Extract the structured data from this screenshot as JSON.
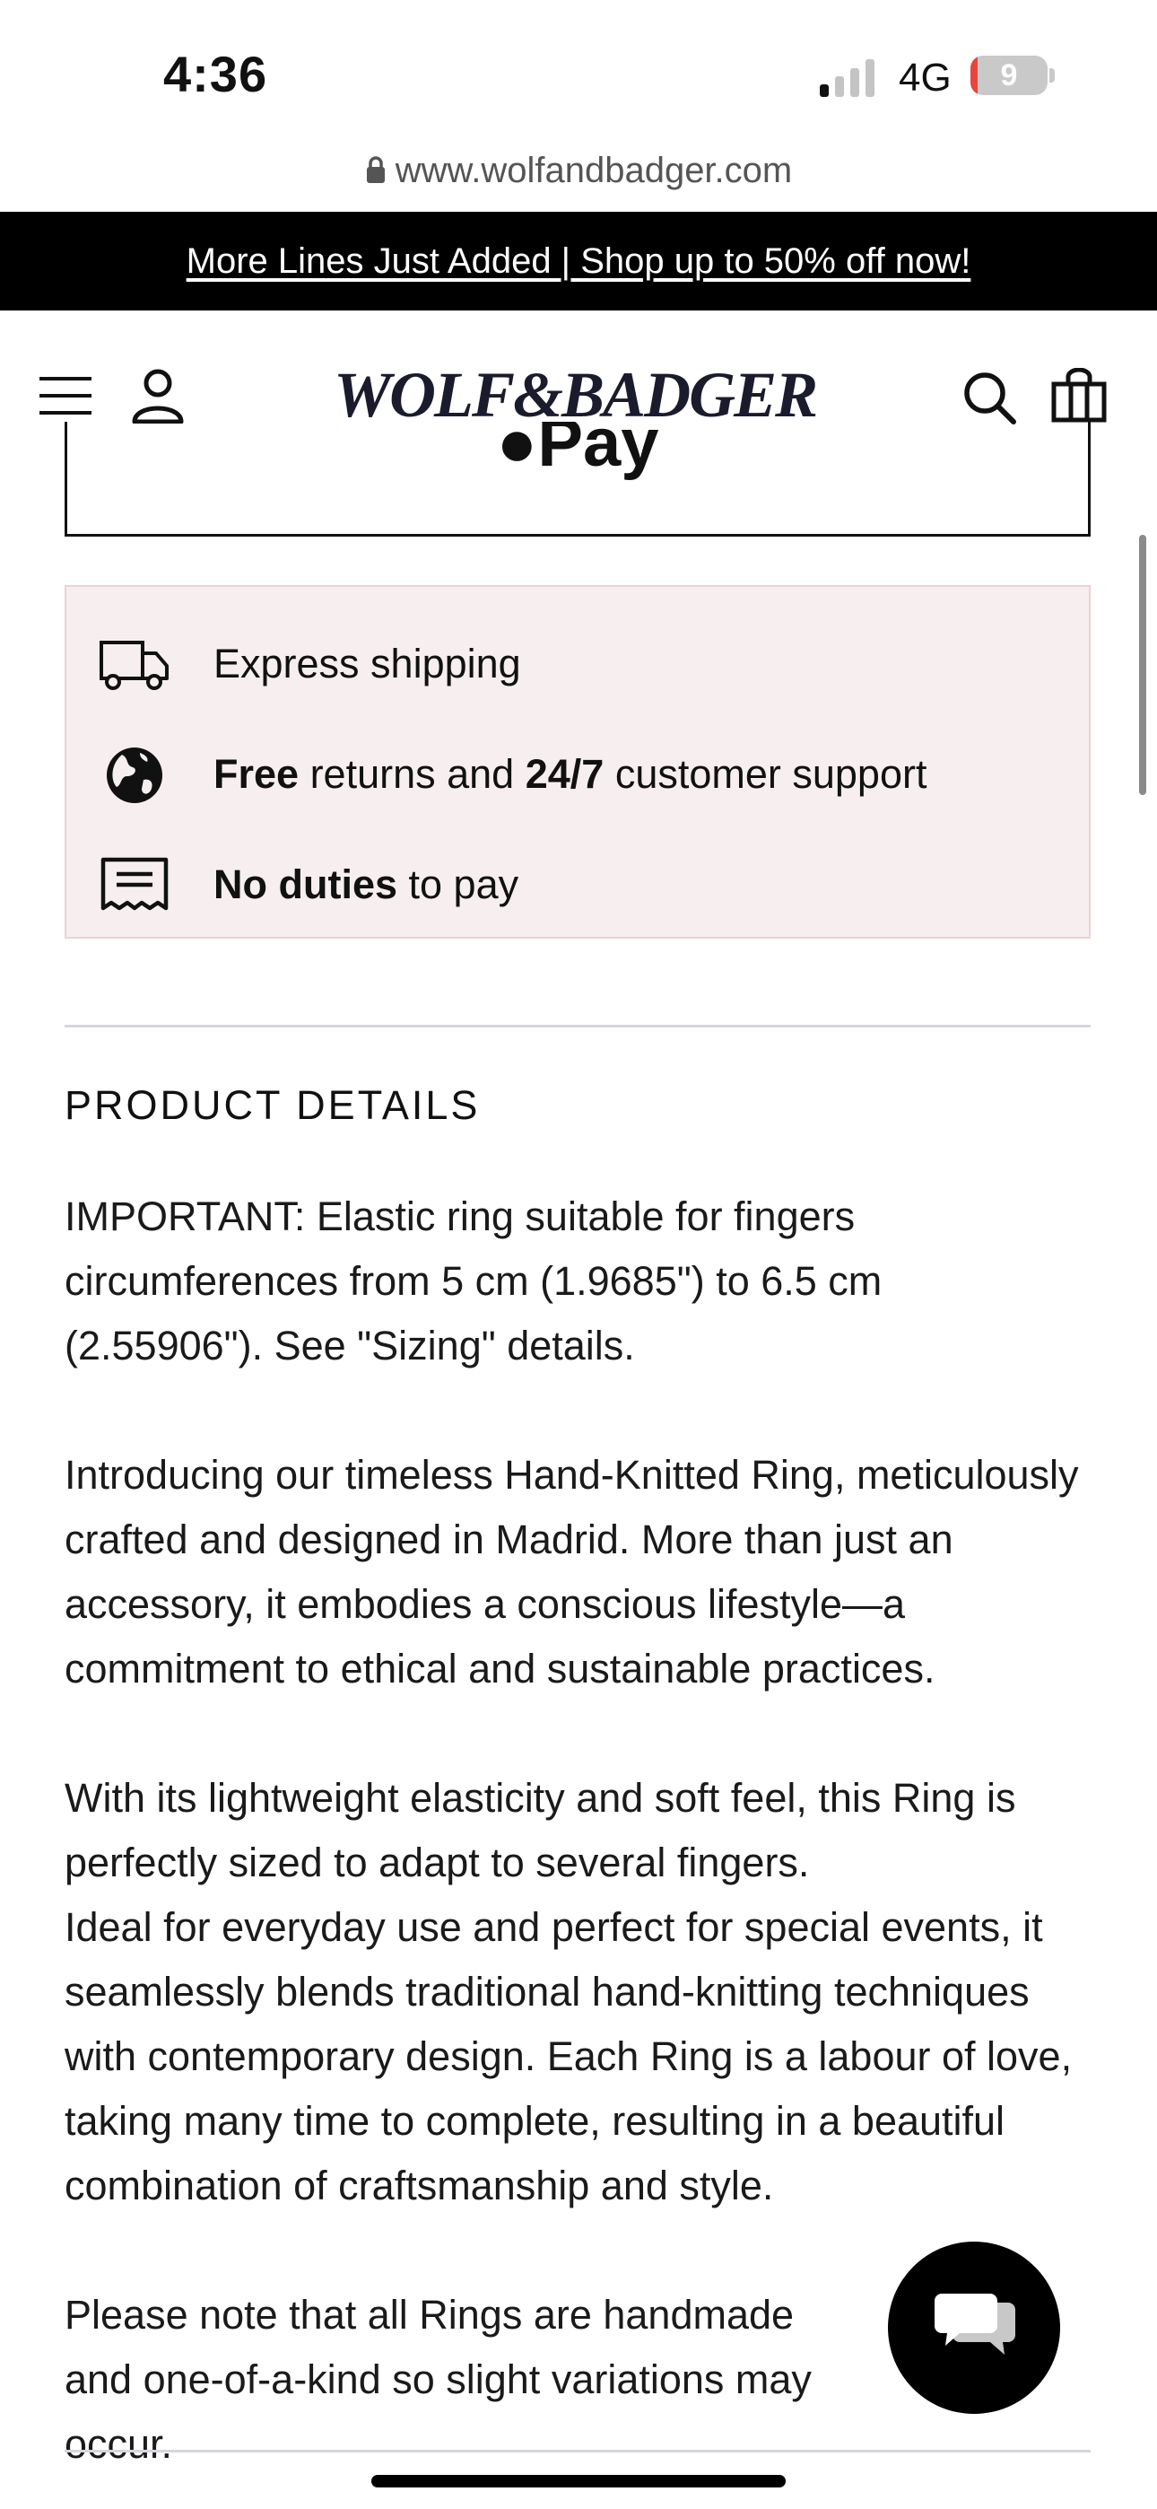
{
  "status_bar": {
    "time": "4:36",
    "network": "4G",
    "battery": "9",
    "battery_fraction": 0.09
  },
  "browser": {
    "url": "www.wolfandbadger.com"
  },
  "promo_banner": {
    "text": "More Lines Just Added | Shop up to 50% off now!"
  },
  "header": {
    "logo": "WOLF&BADGER"
  },
  "pay_button": {
    "label": "Pay"
  },
  "benefits": [
    {
      "icon": "truck-icon",
      "parts": [
        {
          "text": "Express shipping",
          "bold": false
        }
      ]
    },
    {
      "icon": "globe-icon",
      "parts": [
        {
          "text": "Free",
          "bold": true
        },
        {
          "text": " returns and ",
          "bold": false
        },
        {
          "text": "24/7",
          "bold": true
        },
        {
          "text": " customer support",
          "bold": false
        }
      ]
    },
    {
      "icon": "receipt-icon",
      "parts": [
        {
          "text": "No duties",
          "bold": true
        },
        {
          "text": " to pay",
          "bold": false
        }
      ]
    }
  ],
  "product_details": {
    "title": "PRODUCT DETAILS",
    "paragraphs": [
      "IMPORTANT: Elastic ring suitable for fingers circumferences from 5 cm (1.9685\") to 6.5 cm (2.55906\"). See \"Sizing\" details.",
      "Introducing our timeless Hand-Knitted Ring, meticulously crafted and designed in Madrid. More than just an accessory, it embodies a conscious lifestyle—a commitment to ethical and sustainable practices.",
      "With its lightweight elasticity and soft feel, this Ring is perfectly sized to adapt to several fingers.",
      "Ideal for everyday use and perfect for special events, it seamlessly blends traditional hand-knitting techniques with contemporary design. Each Ring is a labour of love, taking many time to complete, resulting in a beautiful combination of craftsmanship and style.",
      "Please note that all Rings are handmade and one-of-a-kind so slight variations may occur."
    ]
  },
  "colors": {
    "banner_bg": "#000000",
    "benefits_bg": "#f7efef",
    "benefits_border": "#ecd3d3",
    "battery_low": "#e8453c"
  }
}
